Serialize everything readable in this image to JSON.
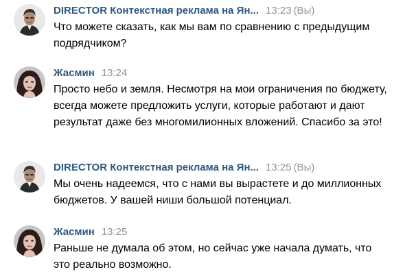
{
  "colors": {
    "author": "#2a5885",
    "meta": "#939393",
    "text": "#000000",
    "background": "#ffffff"
  },
  "messages": [
    {
      "author": "DIRECTOR Контекстная реклама на Ян...",
      "time": "13:23",
      "you": "(Вы)",
      "avatar": "male-avatar",
      "text": "Что можете сказать, как мы вам по сравнению с предыдущим подрядчиком?"
    },
    {
      "author": "Жасмин",
      "time": "13:24",
      "you": "",
      "avatar": "female-avatar",
      "text": "Просто небо и земля. Несмотря на мои ограничения по бюджету, всегда можете предложить услуги, которые работают и дают результат даже без многомилионных вложений. Спасибо за это!"
    },
    {
      "author": "DIRECTOR Контекстная реклама на Ян...",
      "time": "13:25",
      "you": "(Вы)",
      "avatar": "male-avatar",
      "text": "Мы очень надеемся, что с нами вы вырастете и до миллионных бюджетов. У вашей ниши большой потенциал."
    },
    {
      "author": "Жасмин",
      "time": "13:25",
      "you": "",
      "avatar": "female-avatar",
      "text": "Раньше не думала об этом, но сейчас уже начала думать, что это реально возможно."
    }
  ]
}
